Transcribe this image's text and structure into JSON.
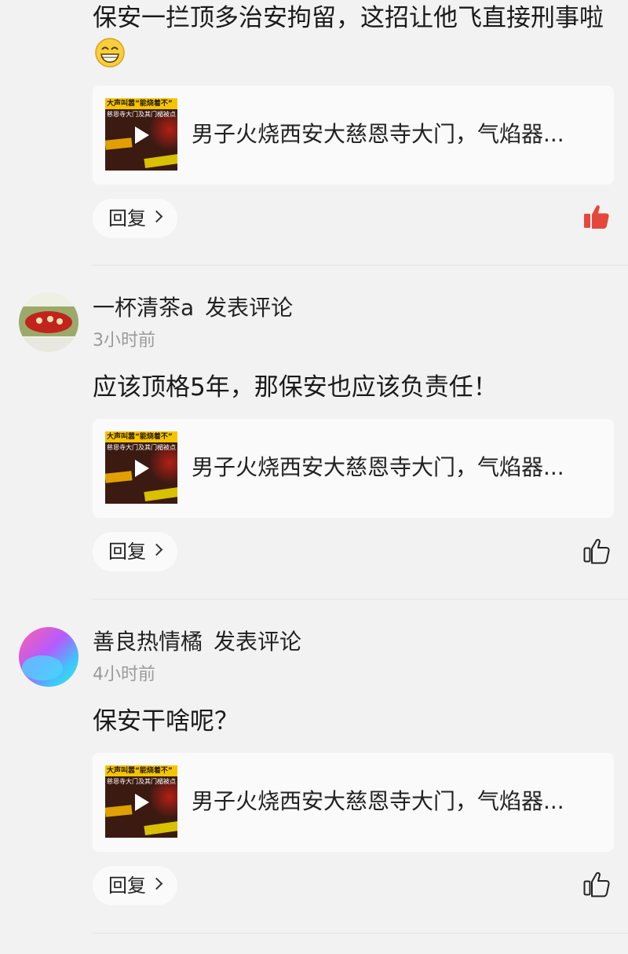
{
  "comments": [
    {
      "text": "保安一拦顶多治安拘留，这招让他飞直接刑事啦",
      "emoji_icon": "grin-emoji-icon",
      "video": {
        "thumb_top": "大声叫嚣“能烧着不”",
        "thumb_sub": "慈恩寺大门及其门楣被点",
        "title": "男子火烧西安大慈恩寺大门，气焰器..."
      },
      "reply_label": "回复",
      "liked": true,
      "like_color": "#e5483b"
    },
    {
      "username": "一杯清茶a",
      "action": "发表评论",
      "time": "3小时前",
      "text": "应该顶格5年，那保安也应该负责任！",
      "video": {
        "thumb_top": "大声叫嚣“能烧着不”",
        "thumb_sub": "慈恩寺大门及其门楣被点",
        "title": "男子火烧西安大慈恩寺大门，气焰器..."
      },
      "reply_label": "回复",
      "liked": false
    },
    {
      "username": "善良热情橘",
      "action": "发表评论",
      "time": "4小时前",
      "text": "保安干啥呢？",
      "video": {
        "thumb_top": "大声叫嚣“能烧着不”",
        "thumb_sub": "慈恩寺大门及其门楣被点",
        "title": "男子火烧西安大慈恩寺大门，气焰器..."
      },
      "reply_label": "回复",
      "liked": false
    }
  ],
  "colors": {
    "background": "#f2f2f2",
    "card": "#fafafa",
    "time_gray": "#9a9a9a",
    "like_red": "#e5483b"
  }
}
